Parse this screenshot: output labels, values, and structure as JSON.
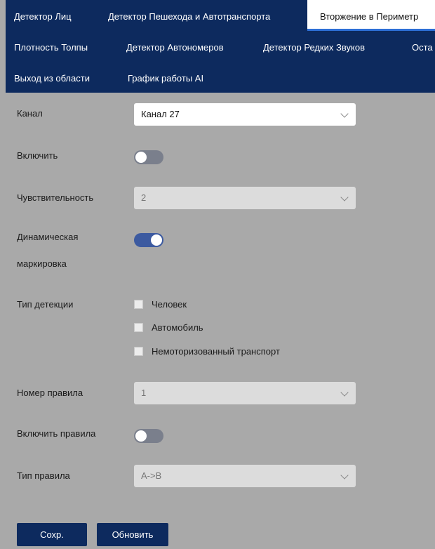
{
  "tabs": {
    "row1": [
      "Детектор Лиц",
      "Детектор Пешехода и Автотранспорта",
      "Вторжение в Периметр"
    ],
    "row2": [
      "Плотность Толпы",
      "Детектор Автономеров",
      "Детектор Редких Звуков",
      "Оста"
    ],
    "row3": [
      "Выход из области",
      "График работы AI"
    ],
    "active": "Вторжение в Периметр"
  },
  "form": {
    "channel_label": "Канал",
    "channel_value": "Канал 27",
    "enable_label": "Включить",
    "enable_state": "off",
    "sensitivity_label": "Чувствительность",
    "sensitivity_value": "2",
    "dynamic_label_line1": "Динамическая",
    "dynamic_label_line2": "маркировка",
    "dynamic_state": "on",
    "detection_type_label": "Тип детекции",
    "detection_types": [
      "Человек",
      "Автомобиль",
      "Немоторизованный транспорт"
    ],
    "rule_number_label": "Номер правила",
    "rule_number_value": "1",
    "enable_rules_label": "Включить правила",
    "enable_rules_state": "off",
    "rule_type_label": "Тип правила",
    "rule_type_value": "A->B"
  },
  "buttons": {
    "save": "Сохр.",
    "refresh": "Обновить"
  },
  "colors": {
    "nav_bg": "#0d2a5e",
    "accent": "#2d6fd6",
    "page_bg": "#a9a9a9",
    "toggle_on": "#3c5aa0"
  }
}
